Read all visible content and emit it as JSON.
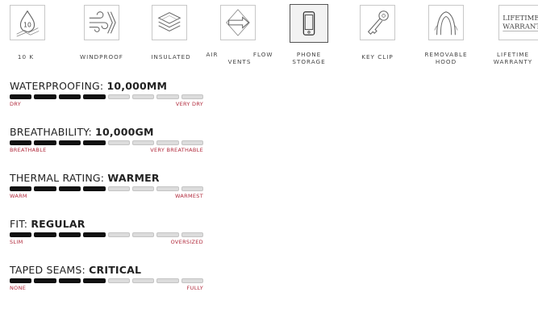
{
  "features": [
    {
      "id": "10k",
      "label": "10 K",
      "icon": "water-drop-10-icon",
      "selected": false
    },
    {
      "id": "windproof",
      "label": "WINDPROOF",
      "icon": "wind-icon",
      "selected": false
    },
    {
      "id": "insulated",
      "label": "INSULATED",
      "icon": "layers-icon",
      "selected": false
    },
    {
      "id": "airflow",
      "label": "AIR FLOW VENTS",
      "icon": "airflow-arrow-icon",
      "selected": false
    },
    {
      "id": "phone",
      "label": "PHONE STORAGE",
      "icon": "phone-icon",
      "selected": true
    },
    {
      "id": "keyclip",
      "label": "KEY CLIP",
      "icon": "key-icon",
      "selected": false
    },
    {
      "id": "hood",
      "label": "REMOVABLE HOOD",
      "icon": "hood-icon",
      "selected": false
    },
    {
      "id": "warranty",
      "label": "LIFETIME WARRANTY",
      "icon": "warranty-icon",
      "icon_text": [
        "LIFETIME",
        "WARRANTY"
      ],
      "selected": false
    }
  ],
  "ratings": [
    {
      "label": "WATERPROOFING: ",
      "value": "10,000MM",
      "filled": 4,
      "total": 8,
      "min": "DRY",
      "max": "VERY DRY"
    },
    {
      "label": "BREATHABILITY: ",
      "value": "10,000GM",
      "filled": 4,
      "total": 8,
      "min": "BREATHABLE",
      "max": "VERY BREATHABLE"
    },
    {
      "label": "THERMAL RATING: ",
      "value": "WARMER",
      "filled": 4,
      "total": 8,
      "min": "WARM",
      "max": "WARMEST"
    },
    {
      "label": "FIT: ",
      "value": "REGULAR",
      "filled": 4,
      "total": 8,
      "min": "SLIM",
      "max": "OVERSIZED"
    },
    {
      "label": "TAPED SEAMS: ",
      "value": "CRITICAL",
      "filled": 4,
      "total": 8,
      "min": "NONE",
      "max": "FULLY"
    }
  ]
}
